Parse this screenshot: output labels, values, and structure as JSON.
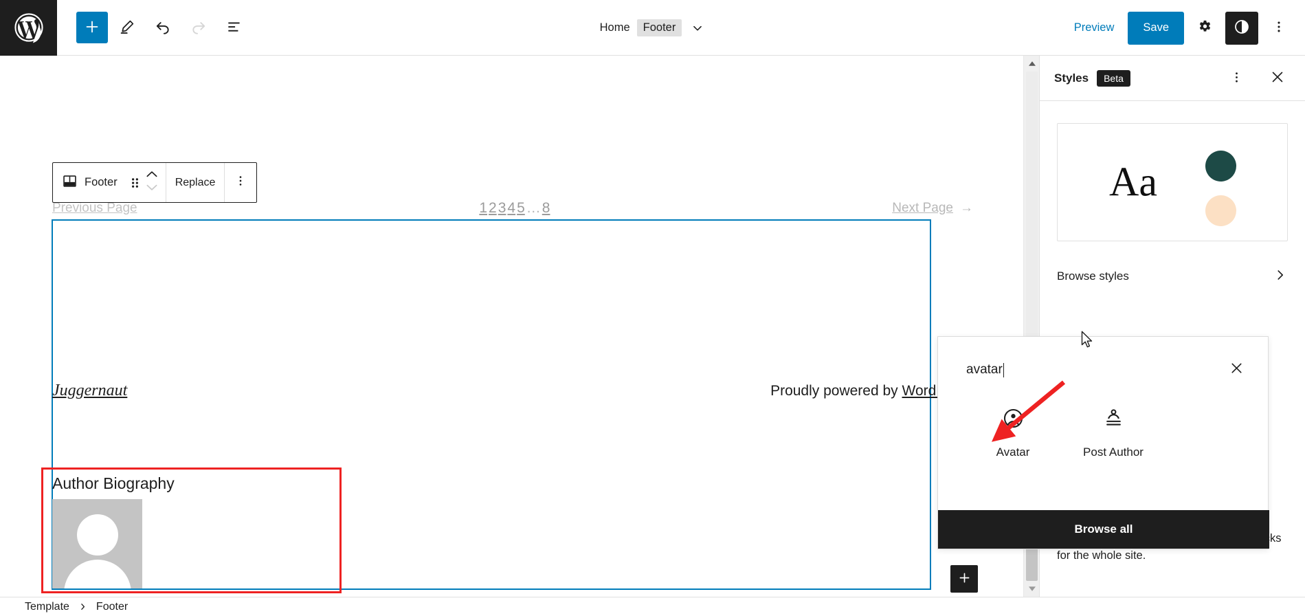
{
  "header": {
    "logo_icon": "wordpress-logo-icon",
    "tools": [
      {
        "name": "add-block-button",
        "icon": "plus-icon",
        "label": "Add block",
        "state": "primary"
      },
      {
        "name": "edit-mode-button",
        "icon": "pencil-icon",
        "label": "Edit",
        "state": "normal"
      },
      {
        "name": "undo-button",
        "icon": "undo-icon",
        "label": "Undo",
        "state": "normal"
      },
      {
        "name": "redo-button",
        "icon": "redo-icon",
        "label": "Redo",
        "state": "disabled"
      },
      {
        "name": "list-view-button",
        "icon": "list-view-icon",
        "label": "List View",
        "state": "normal"
      }
    ],
    "document_bar": {
      "home_label": "Home",
      "title": "Footer",
      "chevron_icon": "chevron-down-icon"
    },
    "preview_label": "Preview",
    "save_label": "Save",
    "settings_icon": "gear-icon",
    "styles_icon": "contrast-icon",
    "options_icon": "kebab-menu-icon",
    "accent_color": "#007cba",
    "dark_color": "#1e1e1e"
  },
  "block_toolbar": {
    "block_icon": "footer-block-icon",
    "block_name": "Footer",
    "drag_icon": "drag-handle-icon",
    "move_up_icon": "chevron-up-icon",
    "move_down_icon": "chevron-down-icon",
    "replace_label": "Replace",
    "options_icon": "kebab-menu-icon"
  },
  "canvas": {
    "pagination": {
      "previous_label": "Previous Page",
      "numbers": [
        "1",
        "2",
        "3",
        "4",
        "5"
      ],
      "ellipsis": "…",
      "last": "8",
      "next_label": "Next Page",
      "next_arrow": "→",
      "prev_arrow": "←"
    },
    "footer_block": {
      "site_title": "Juggernaut",
      "powered_prefix": "Proudly powered by ",
      "powered_link": "WordPress"
    },
    "author_bio": {
      "heading": "Author Biography",
      "avatar_icon": "avatar-placeholder-icon"
    },
    "appender_icon": "plus-icon",
    "selection_color": "#007cba",
    "highlight_color": "#ee2222"
  },
  "sidebar": {
    "title": "Styles",
    "badge": "Beta",
    "more_icon": "kebab-menu-icon",
    "close_icon": "close-icon",
    "preview": {
      "sample_text": "Aa",
      "swatch_primary": "#1d4a46",
      "swatch_secondary": "#fce0c4"
    },
    "browse_styles_label": "Browse styles",
    "browse_styles_icon": "chevron-right-icon",
    "blocks_description": "Customize the appearance of specific blocks for the whole site."
  },
  "inserter": {
    "search_value": "avatar",
    "clear_icon": "close-icon",
    "results": [
      {
        "label": "Avatar",
        "icon": "avatar-icon"
      },
      {
        "label": "Post Author",
        "icon": "post-author-icon"
      }
    ],
    "browse_all_label": "Browse all"
  },
  "annotation": {
    "arrow_icon": "red-arrow-icon",
    "arrow_color": "#ee2222"
  },
  "breadcrumb": {
    "items": [
      "Template",
      "Footer"
    ],
    "separator_icon": "chevron-right-icon"
  }
}
